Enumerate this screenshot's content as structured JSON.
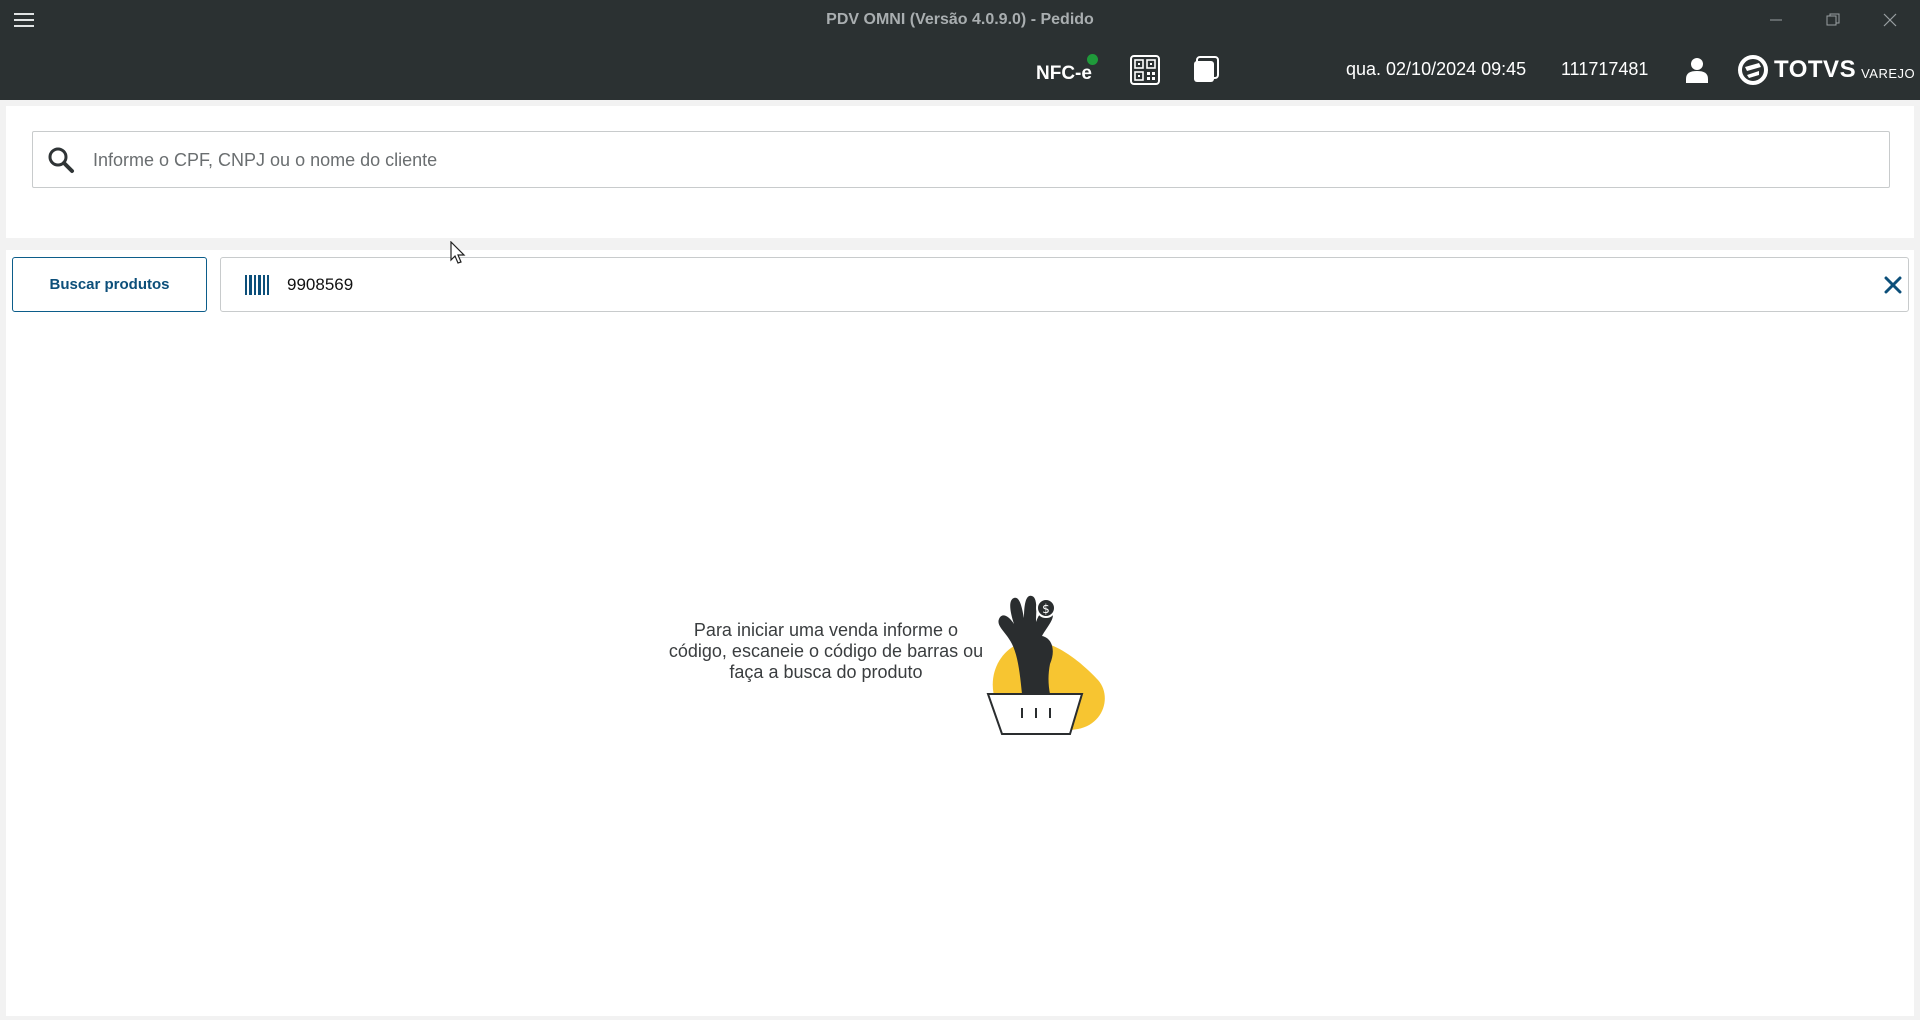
{
  "window": {
    "title": "PDV OMNI (Versão 4.0.9.0) - Pedido"
  },
  "toolbar": {
    "nfce_label": "NFC-e",
    "nfce_status_color": "#1f9a3a",
    "datetime": "qua. 02/10/2024 09:45",
    "terminal_id": "111717481",
    "brand_name": "TOTVS",
    "brand_sub": "VAREJO"
  },
  "client": {
    "search_placeholder": "Informe o CPF, CNPJ ou o nome do cliente",
    "search_value": ""
  },
  "products": {
    "search_button_label": "Buscar produtos",
    "barcode_value": "9908569"
  },
  "empty_state": {
    "message": "Para iniciar uma venda informe o código, escaneie o código de barras ou faça a busca do produto"
  },
  "colors": {
    "header_bg": "#2b3132",
    "accent": "#0c5d8a",
    "illustration_yellow": "#f7c531"
  }
}
